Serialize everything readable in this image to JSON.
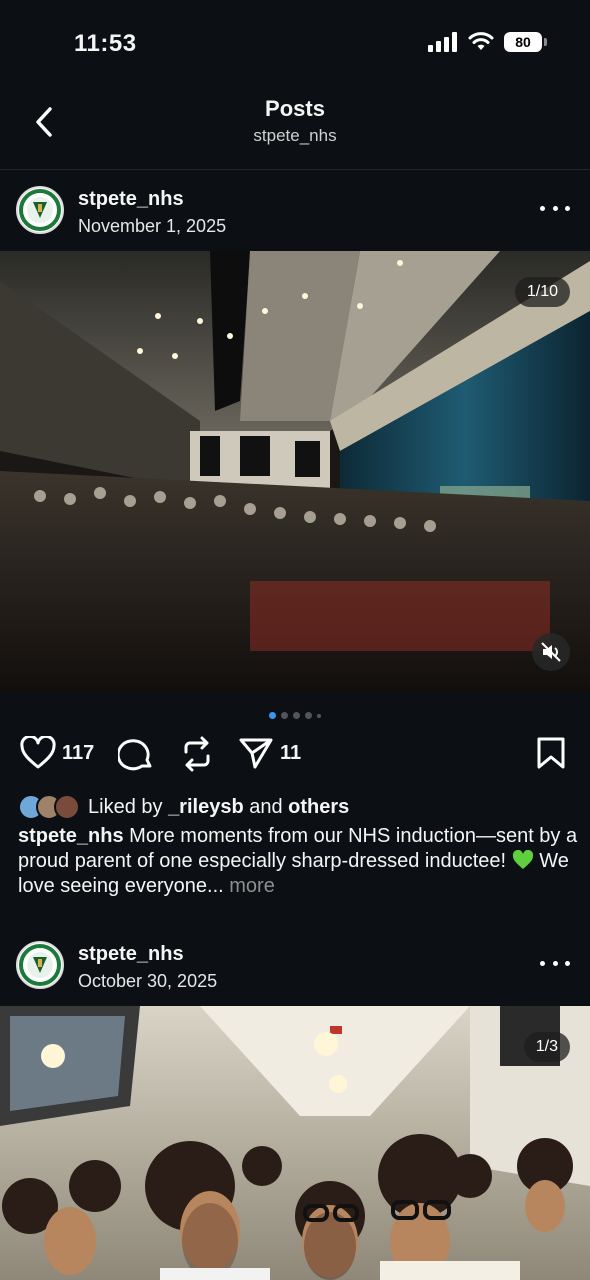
{
  "status_bar": {
    "time": "11:53",
    "battery": "80"
  },
  "header": {
    "title": "Posts",
    "subtitle": "stpete_nhs"
  },
  "posts": [
    {
      "username": "stpete_nhs",
      "date": "November 1, 2025",
      "media_counter": "1/10",
      "likes": "117",
      "shares": "11",
      "liked_by_prefix": "Liked by",
      "liked_by_user": "_rileysb",
      "liked_by_and": "and",
      "liked_by_others": "others",
      "caption_user": "stpete_nhs",
      "caption_text_1": "More moments from our NHS induction—sent by a proud parent of one especially sharp-dressed inductee!",
      "caption_text_2": "We love seeing everyone...",
      "caption_more": "more"
    },
    {
      "username": "stpete_nhs",
      "date": "October 30, 2025",
      "media_counter": "1/3"
    }
  ],
  "icons": {
    "back": "chevron-left-icon",
    "more": "more-horizontal-icon",
    "mute": "speaker-muted-icon",
    "like": "heart-icon",
    "comment": "comment-bubble-icon",
    "repost": "repost-icon",
    "share": "paper-plane-icon",
    "save": "bookmark-icon"
  },
  "colors": {
    "background": "#0c1014",
    "accent": "#3897f0",
    "emoji_heart": "#5fcf3d"
  }
}
